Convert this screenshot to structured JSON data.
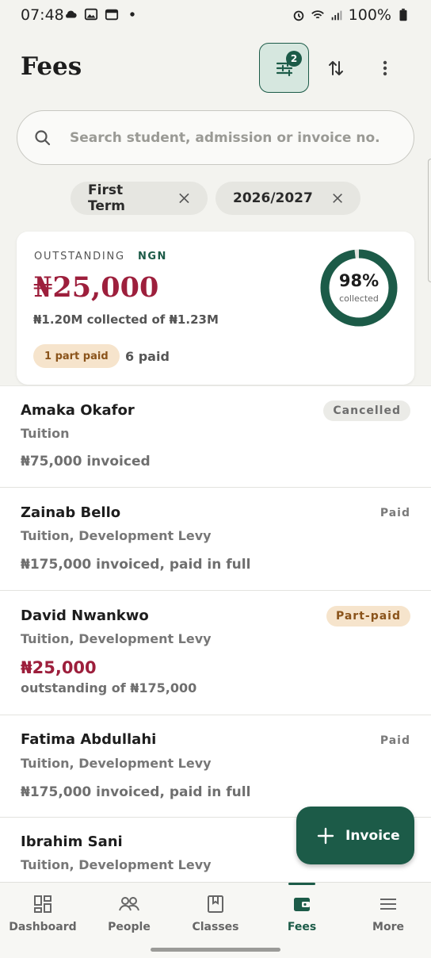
{
  "status_bar": {
    "time": "07:48",
    "battery": "100%"
  },
  "header": {
    "title": "Fees",
    "filter_count": "2"
  },
  "search": {
    "placeholder": "Search student, admission or invoice no.",
    "value": ""
  },
  "filters": [
    {
      "label": "First Term"
    },
    {
      "label": "2026/2027"
    }
  ],
  "summary": {
    "label": "OUTSTANDING",
    "currency": "NGN",
    "amount": "₦25,000",
    "collected_text": "₦1.20M collected of ₦1.23M",
    "part_paid_label": "1 part paid",
    "paid_label": "6 paid",
    "percent": "98%",
    "percent_label": "collected",
    "collected_fraction": 0.98
  },
  "invoices": [
    {
      "name": "Amaka Okafor",
      "items": "Tuition",
      "amount_text": "₦75,000 invoiced",
      "status": "Cancelled"
    },
    {
      "name": "Zainab Bello",
      "items": "Tuition, Development Levy",
      "amount_text": "₦175,000 invoiced, paid in full",
      "status": "Paid"
    },
    {
      "name": "David Nwankwo",
      "items": "Tuition, Development Levy",
      "outstanding": "₦25,000",
      "outstanding_sub": "outstanding of ₦175,000",
      "status": "Part-paid"
    },
    {
      "name": "Fatima Abdullahi",
      "items": "Tuition, Development Levy",
      "amount_text": "₦175,000 invoiced, paid in full",
      "status": "Paid"
    },
    {
      "name": "Ibrahim Sani",
      "items": "Tuition, Development Levy"
    }
  ],
  "fab": {
    "label": "Invoice"
  },
  "nav": [
    {
      "label": "Dashboard",
      "icon": "dashboard-icon"
    },
    {
      "label": "People",
      "icon": "people-icon"
    },
    {
      "label": "Classes",
      "icon": "book-icon"
    },
    {
      "label": "Fees",
      "icon": "wallet-icon",
      "active": true
    },
    {
      "label": "More",
      "icon": "menu-icon"
    }
  ],
  "colors": {
    "accent": "#1c5b48",
    "outstanding": "#9d1f3c",
    "part_paid_bg": "#f6e4cc"
  }
}
